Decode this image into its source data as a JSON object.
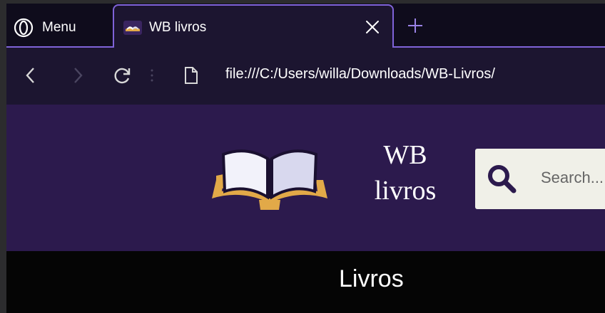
{
  "browser": {
    "menu_label": "Menu",
    "tab": {
      "title": "WB livros",
      "favicon": "book-icon"
    },
    "address": "file:///C:/Users/willa/Downloads/WB-Livros/"
  },
  "site": {
    "brand_line1": "WB",
    "brand_line2": "livros",
    "search_placeholder": "Search...",
    "nav": [
      "Livros"
    ]
  },
  "colors": {
    "header_bg": "#2c1a4d",
    "accent": "#7f63d8",
    "book_cover": "#e2a948"
  }
}
